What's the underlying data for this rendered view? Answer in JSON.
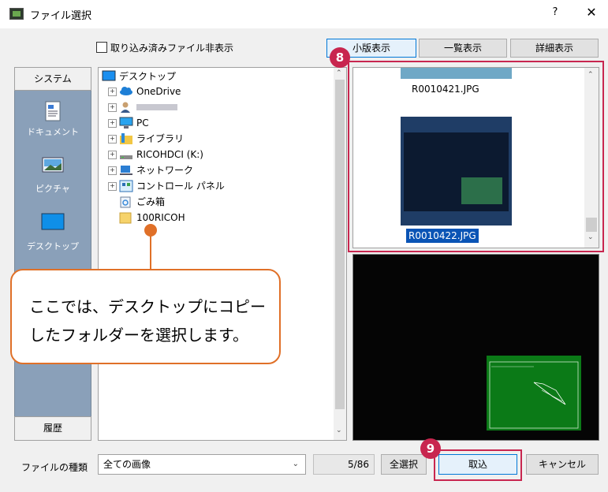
{
  "window": {
    "title": "ファイル選択",
    "help": "?",
    "close": "✕"
  },
  "checkbox": {
    "label": "取り込み済みファイル非表示"
  },
  "view_tabs": [
    "小版表示",
    "一覧表示",
    "詳細表示"
  ],
  "system_panel": {
    "header": "システム",
    "items": [
      {
        "label": "ドキュメント",
        "icon": "document-icon"
      },
      {
        "label": "ピクチャ",
        "icon": "pictures-icon"
      },
      {
        "label": "デスクトップ",
        "icon": "desktop-icon"
      }
    ],
    "footer": "履歴"
  },
  "tree": {
    "root": "デスクトップ",
    "items": [
      {
        "label": "OneDrive",
        "icon": "cloud-icon"
      },
      {
        "label": "",
        "icon": "user-icon"
      },
      {
        "label": "PC",
        "icon": "pc-icon"
      },
      {
        "label": "ライブラリ",
        "icon": "library-icon"
      },
      {
        "label": "RICOHDCI (K:)",
        "icon": "drive-icon"
      },
      {
        "label": "ネットワーク",
        "icon": "network-icon"
      },
      {
        "label": "コントロール パネル",
        "icon": "control-panel-icon"
      },
      {
        "label": "ごみ箱",
        "icon": "recycle-bin-icon"
      },
      {
        "label": "100RICOH",
        "icon": "folder-icon"
      }
    ]
  },
  "thumbnails": [
    {
      "filename": "R0010421.JPG",
      "selected": false
    },
    {
      "filename": "R0010422.JPG",
      "selected": true
    }
  ],
  "file_type": {
    "label": "ファイルの種類",
    "value": "全ての画像"
  },
  "count": "5/86",
  "buttons": {
    "select_all": "全選択",
    "import": "取込",
    "cancel": "キャンセル"
  },
  "annotations": {
    "badge8": "8",
    "badge9": "9",
    "callout_line1": "ここでは、デスクトップにコピー",
    "callout_line2": "したフォルダーを選択します。"
  },
  "colors": {
    "accent": "#c8264f",
    "callout": "#e07028",
    "selection": "#0a54b5"
  }
}
